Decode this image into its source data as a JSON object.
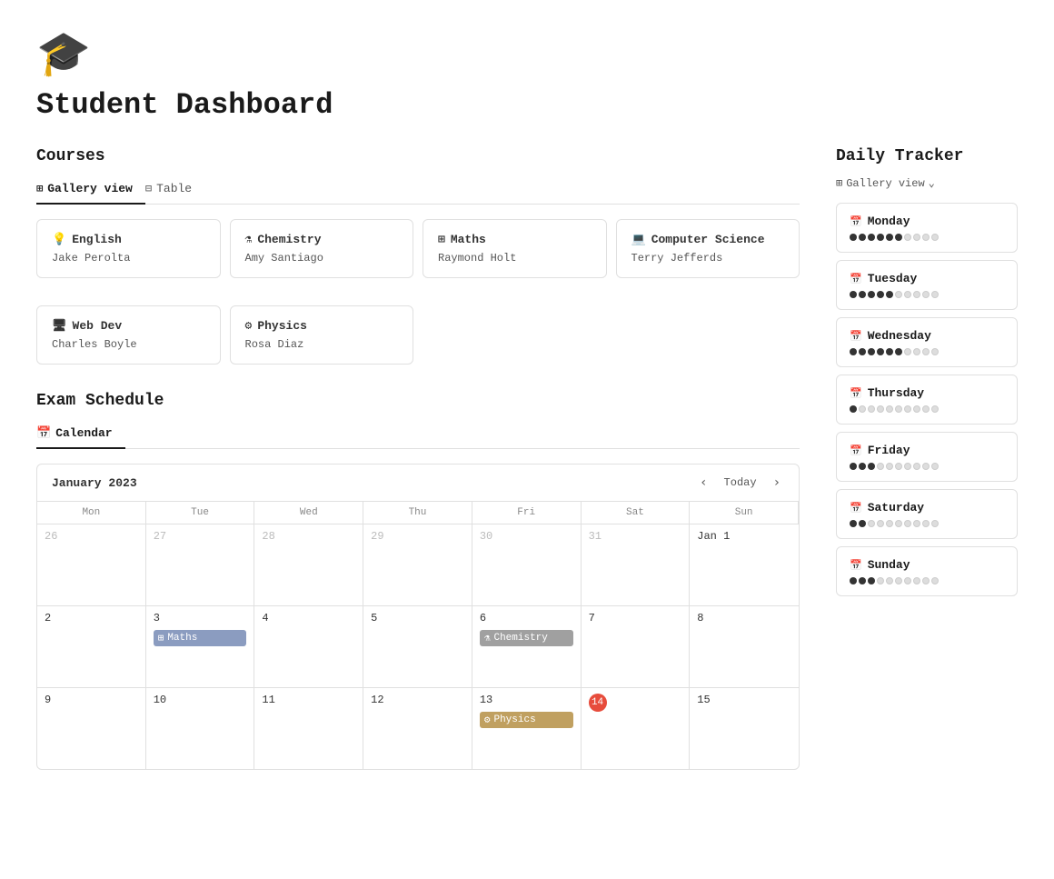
{
  "app": {
    "logo": "🎓",
    "title": "Student Dashboard"
  },
  "courses": {
    "section_title": "Courses",
    "tabs": [
      {
        "label": "Gallery view",
        "icon": "⊞",
        "active": true
      },
      {
        "label": "Table",
        "icon": "⊟",
        "active": false
      }
    ],
    "cards_row1": [
      {
        "icon": "💡",
        "name": "English",
        "teacher": "Jake Perolta"
      },
      {
        "icon": "⚗",
        "name": "Chemistry",
        "teacher": "Amy Santiago"
      },
      {
        "icon": "⊞",
        "name": "Maths",
        "teacher": "Raymond Holt"
      },
      {
        "icon": "💻",
        "name": "Computer Science",
        "teacher": "Terry Jefferds"
      }
    ],
    "cards_row2": [
      {
        "icon": "🖥",
        "name": "Web Dev",
        "teacher": "Charles Boyle"
      },
      {
        "icon": "⚙",
        "name": "Physics",
        "teacher": "Rosa Diaz"
      },
      null,
      null
    ]
  },
  "exam_schedule": {
    "section_title": "Exam Schedule",
    "tab": {
      "label": "Calendar",
      "icon": "📅"
    },
    "month": "January 2023",
    "today_label": "Today",
    "day_headers": [
      "Mon",
      "Tue",
      "Wed",
      "Thu",
      "Fri",
      "Sat",
      "Sun"
    ],
    "weeks": [
      [
        {
          "day": "26",
          "other": true,
          "events": []
        },
        {
          "day": "27",
          "other": true,
          "events": []
        },
        {
          "day": "28",
          "other": true,
          "events": []
        },
        {
          "day": "29",
          "other": true,
          "events": []
        },
        {
          "day": "30",
          "other": true,
          "events": []
        },
        {
          "day": "31",
          "other": true,
          "events": []
        },
        {
          "day": "Jan 1",
          "other": false,
          "events": []
        }
      ],
      [
        {
          "day": "2",
          "other": false,
          "events": []
        },
        {
          "day": "3",
          "other": false,
          "events": [
            {
              "label": "Maths",
              "type": "maths",
              "icon": "⊞"
            }
          ]
        },
        {
          "day": "4",
          "other": false,
          "events": []
        },
        {
          "day": "5",
          "other": false,
          "events": []
        },
        {
          "day": "6",
          "other": false,
          "events": [
            {
              "label": "Chemistry",
              "type": "chemistry",
              "icon": "⚗"
            }
          ]
        },
        {
          "day": "7",
          "other": false,
          "events": []
        },
        {
          "day": "8",
          "other": false,
          "events": []
        }
      ],
      [
        {
          "day": "9",
          "other": false,
          "events": []
        },
        {
          "day": "10",
          "other": false,
          "events": []
        },
        {
          "day": "11",
          "other": false,
          "events": []
        },
        {
          "day": "12",
          "other": false,
          "events": []
        },
        {
          "day": "13",
          "other": false,
          "events": [
            {
              "label": "Physics",
              "type": "physics",
              "icon": "⚙"
            }
          ]
        },
        {
          "day": "14",
          "other": false,
          "today": true,
          "events": []
        },
        {
          "day": "15",
          "other": false,
          "events": []
        }
      ]
    ]
  },
  "daily_tracker": {
    "section_title": "Daily Tracker",
    "view_label": "Gallery view",
    "view_icon": "⊞",
    "days": [
      {
        "name": "Monday",
        "filled": 6,
        "total": 10
      },
      {
        "name": "Tuesday",
        "filled": 5,
        "total": 10
      },
      {
        "name": "Wednesday",
        "filled": 6,
        "total": 10
      },
      {
        "name": "Thursday",
        "filled": 1,
        "total": 10
      },
      {
        "name": "Friday",
        "filled": 3,
        "total": 10
      },
      {
        "name": "Saturday",
        "filled": 2,
        "total": 10
      },
      {
        "name": "Sunday",
        "filled": 3,
        "total": 10
      }
    ]
  }
}
